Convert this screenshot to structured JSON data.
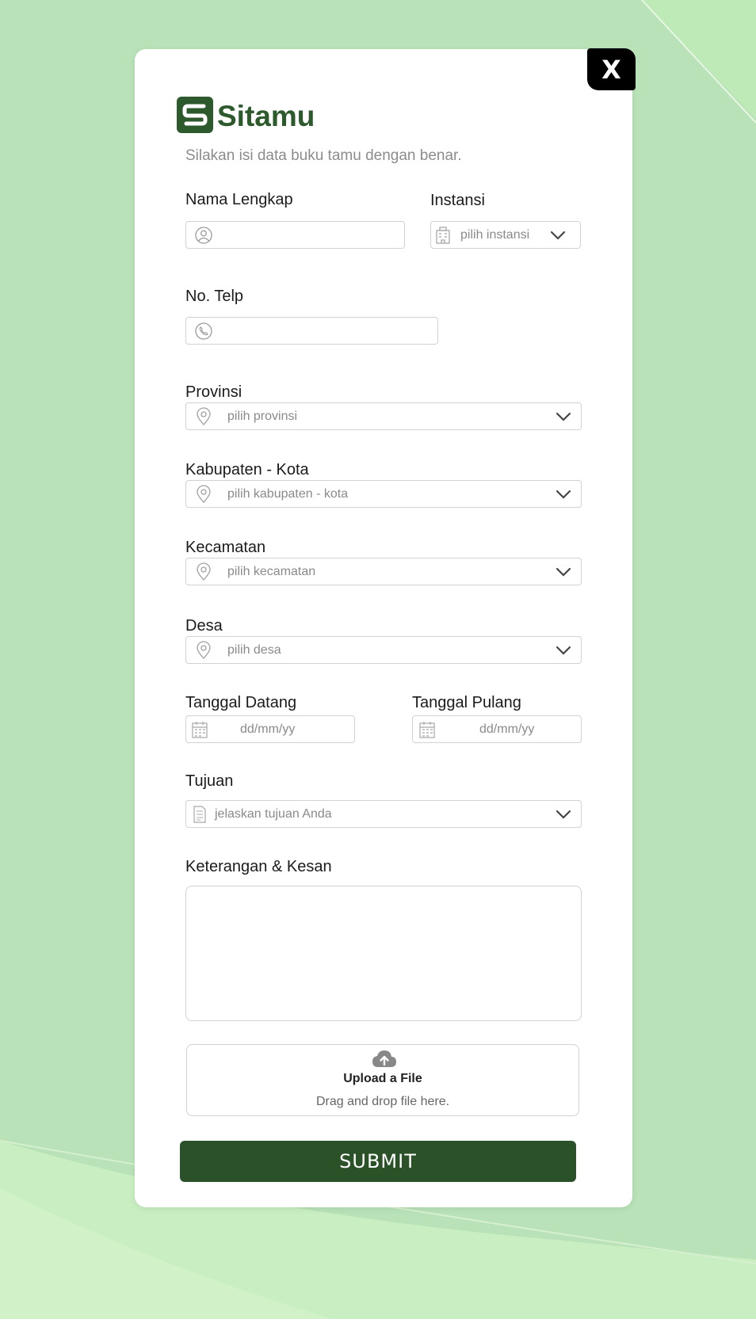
{
  "close_label": "X",
  "brand": {
    "name": "Sitamu",
    "subtitle": "Silakan isi data buku tamu dengan benar."
  },
  "form": {
    "nama": {
      "label": "Nama Lengkap",
      "value": ""
    },
    "instansi": {
      "label": "Instansi",
      "placeholder": "pilih instansi"
    },
    "telp": {
      "label": "No. Telp",
      "value": ""
    },
    "provinsi": {
      "label": "Provinsi",
      "placeholder": "pilih provinsi"
    },
    "kabupaten": {
      "label": "Kabupaten - Kota",
      "placeholder": "pilih kabupaten - kota"
    },
    "kecamatan": {
      "label": "Kecamatan",
      "placeholder": "pilih kecamatan"
    },
    "desa": {
      "label": "Desa",
      "placeholder": "pilih desa"
    },
    "tanggal_datang": {
      "label": "Tanggal Datang",
      "placeholder": "dd/mm/yy"
    },
    "tanggal_pulang": {
      "label": "Tanggal Pulang",
      "placeholder": "dd/mm/yy"
    },
    "tujuan": {
      "label": "Tujuan",
      "placeholder": "jelaskan tujuan Anda"
    },
    "keterangan": {
      "label": "Keterangan & Kesan",
      "value": ""
    }
  },
  "upload": {
    "title": "Upload a File",
    "subtitle": "Drag and drop file here."
  },
  "submit_label": "SUBMIT",
  "colors": {
    "brand_green": "#2b5129",
    "background": "#b9e2b8",
    "close_bg": "#000000"
  },
  "icons": [
    "user-icon",
    "building-icon",
    "phone-icon",
    "location-pin-icon",
    "calendar-icon",
    "document-icon",
    "chevron-down-icon",
    "cloud-upload-icon"
  ]
}
